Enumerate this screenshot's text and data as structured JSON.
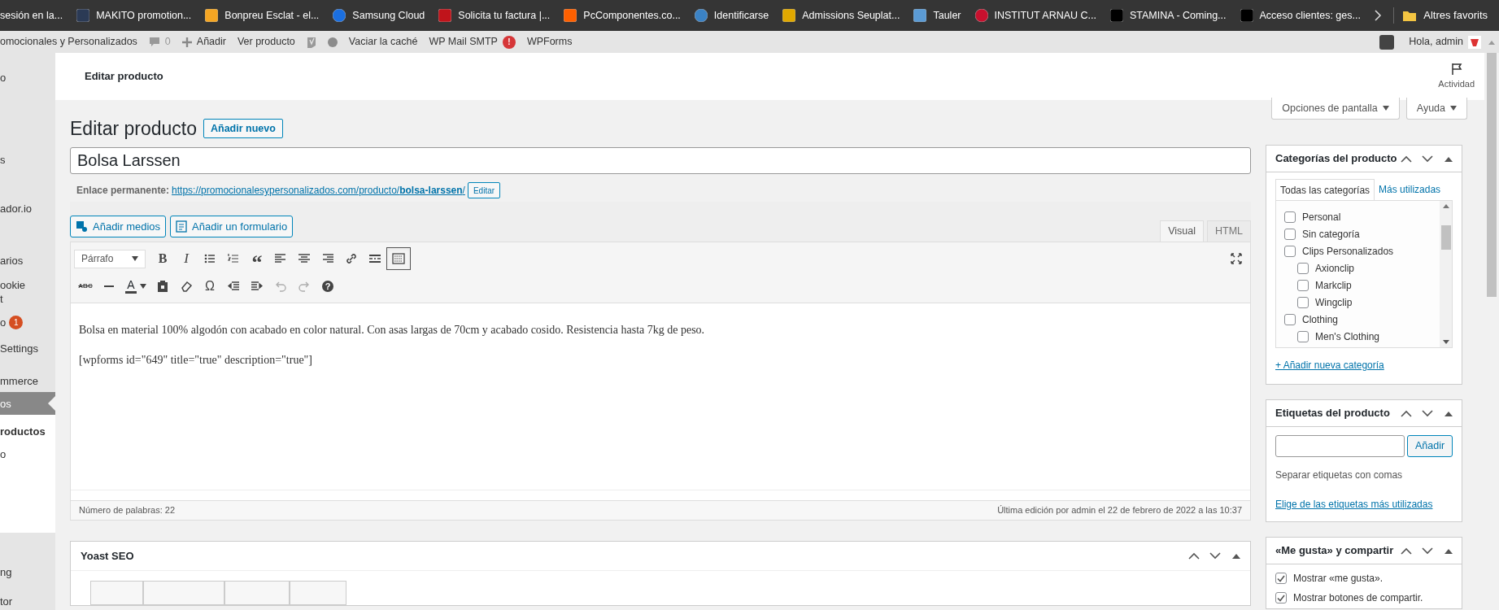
{
  "bookmarks": [
    {
      "label": "sesión en la..."
    },
    {
      "label": "MAKITO promotion..."
    },
    {
      "label": "Bonpreu Esclat - el..."
    },
    {
      "label": "Samsung Cloud"
    },
    {
      "label": "Solicita tu factura |..."
    },
    {
      "label": "PcComponentes.co..."
    },
    {
      "label": "Identificarse"
    },
    {
      "label": "Admissions Seuplat..."
    },
    {
      "label": "Tauler"
    },
    {
      "label": "INSTITUT ARNAU C..."
    },
    {
      "label": "STAMINA - Coming..."
    },
    {
      "label": "Acceso clientes: ges..."
    }
  ],
  "bookmarks_folder": "Altres favorits",
  "admin_bar": {
    "site": "omocionales y Personalizados",
    "comments": "0",
    "new": "Añadir",
    "view": "Ver producto",
    "cache": "Vaciar la caché",
    "mail": "WP Mail SMTP",
    "mail_badge": "!",
    "forms": "WPForms",
    "greeting": "Hola, admin"
  },
  "sidebar": [
    {
      "label": "o",
      "selected": false
    },
    {
      "label": "s",
      "selected": false
    },
    {
      "label": "ador.io",
      "selected": false
    },
    {
      "label": "arios",
      "selected": false
    },
    {
      "label": "ookie\nt",
      "selected": false
    },
    {
      "label": "o",
      "selected": false,
      "badge": "1"
    },
    {
      "label": "Settings",
      "selected": false
    },
    {
      "label": "mmerce",
      "selected": false
    },
    {
      "label": "os",
      "selected": true,
      "submenu": [
        {
          "label": "roductos",
          "selected": true
        },
        {
          "label": "o",
          "selected": false
        }
      ]
    },
    {
      "label": "ng",
      "selected": false
    },
    {
      "label": "tor",
      "selected": false
    }
  ],
  "header": {
    "title": "Editar producto",
    "activity": "Actividad"
  },
  "screen_buttons": [
    "Opciones de pantalla",
    "Ayuda"
  ],
  "page_title": "Editar producto",
  "add_new": "Añadir nuevo",
  "product_title": "Bolsa Larssen",
  "permalink": {
    "label": "Enlace permanente:",
    "url": "https://promocionalesypersonalizados.com/producto/**bolsa-larssen**/",
    "edit": "Editar"
  },
  "media_buttons": [
    "Añadir medios",
    "Añadir un formulario"
  ],
  "editor_tabs": [
    {
      "label": "Visual",
      "selected": true
    },
    {
      "label": "HTML",
      "selected": false
    }
  ],
  "toolbar": [
    [
      {
        "kind": "select",
        "label": "Párrafo",
        "pressed": false,
        "disabled": false
      },
      {
        "kind": "bold",
        "label": "B",
        "pressed": false,
        "disabled": false
      },
      {
        "kind": "italic",
        "label": "I",
        "pressed": false,
        "disabled": false
      },
      {
        "kind": "bullets",
        "pressed": false,
        "disabled": false
      },
      {
        "kind": "numbers",
        "pressed": false,
        "disabled": false
      },
      {
        "kind": "quote",
        "label": "“",
        "pressed": false,
        "disabled": false
      },
      {
        "kind": "align-left",
        "pressed": false,
        "disabled": false
      },
      {
        "kind": "align-center",
        "pressed": false,
        "disabled": false
      },
      {
        "kind": "align-right",
        "pressed": false,
        "disabled": false
      },
      {
        "kind": "link",
        "pressed": false,
        "disabled": false
      },
      {
        "kind": "more",
        "pressed": false,
        "disabled": false
      },
      {
        "kind": "kitchen",
        "pressed": true,
        "disabled": false
      }
    ],
    [
      {
        "kind": "strike",
        "label": "ABC",
        "pressed": false,
        "disabled": false
      },
      {
        "kind": "rule",
        "pressed": false,
        "disabled": false
      },
      {
        "kind": "color",
        "label": "A",
        "pressed": false,
        "disabled": false
      },
      {
        "kind": "paste",
        "pressed": false,
        "disabled": false
      },
      {
        "kind": "eraser",
        "pressed": false,
        "disabled": false
      },
      {
        "kind": "char",
        "label": "Ω",
        "pressed": false,
        "disabled": false
      },
      {
        "kind": "outdent",
        "pressed": false,
        "disabled": false
      },
      {
        "kind": "indent",
        "pressed": false,
        "disabled": false
      },
      {
        "kind": "undo",
        "pressed": false,
        "disabled": true
      },
      {
        "kind": "redo",
        "pressed": false,
        "disabled": true
      },
      {
        "kind": "help",
        "label": "?",
        "pressed": false,
        "disabled": false
      }
    ]
  ],
  "content": [
    "Bolsa en material 100% algodón con acabado en color natural. Con asas largas de 70cm y acabado cosido. Resistencia hasta 7kg de peso.",
    "[wpforms id=\"649\" title=\"true\" description=\"true\"]"
  ],
  "word_count": "Número de palabras: 22",
  "last_edit": "Última edición por admin el 22 de febrero de 2022 a las 10:37",
  "yoast": {
    "title": "Yoast SEO"
  },
  "categories": {
    "title": "Categorías del producto",
    "tabs": [
      {
        "label": "Todas las categorías",
        "selected": true
      },
      {
        "label": "Más utilizadas",
        "selected": false
      }
    ],
    "items": [
      {
        "label": "Personal",
        "checked": false
      },
      {
        "label": "Sin categoría",
        "checked": false
      },
      {
        "label": "Clips Personalizados",
        "checked": false,
        "children": [
          {
            "label": "Axionclip",
            "checked": false
          },
          {
            "label": "Markclip",
            "checked": false
          },
          {
            "label": "Wingclip",
            "checked": false
          }
        ]
      },
      {
        "label": "Clothing",
        "checked": false,
        "children": [
          {
            "label": "Men's Clothing",
            "checked": false
          }
        ]
      }
    ],
    "add": "+ Añadir nueva categoría"
  },
  "tags": {
    "title": "Etiquetas del producto",
    "button": "Añadir",
    "hint": "Separar etiquetas con comas",
    "link": "Elige de las etiquetas más utilizadas"
  },
  "likes": {
    "title": "«Me gusta» y compartir",
    "options": [
      {
        "label": "Mostrar «me gusta».",
        "checked": true
      },
      {
        "label": "Mostrar botones de compartir.",
        "checked": true
      }
    ]
  }
}
